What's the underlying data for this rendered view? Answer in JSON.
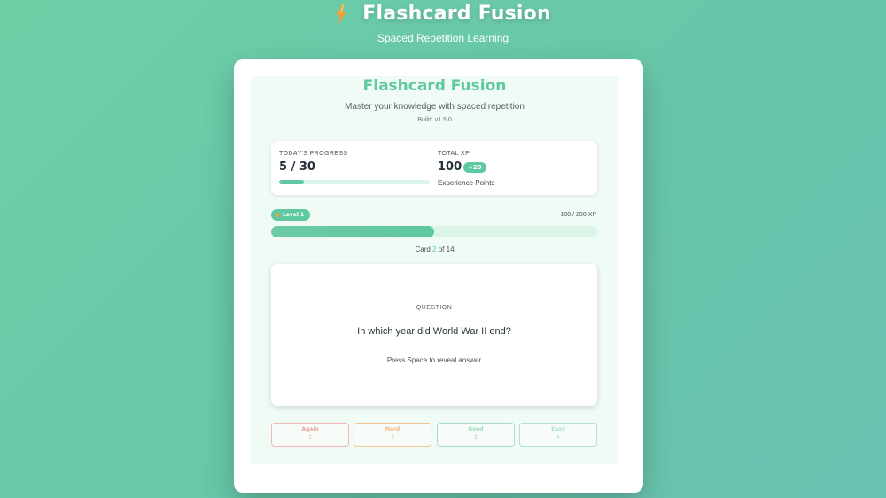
{
  "app": {
    "title": "Flashcard Fusion",
    "subtitle": "Spaced Repetition Learning",
    "icon": "lightning-bolt-icon"
  },
  "panel": {
    "title": "Flashcard Fusion",
    "tagline": "Master your knowledge with spaced repetition",
    "build": "Build: v1.5.0"
  },
  "stats": {
    "progress_label": "TODAY'S PROGRESS",
    "progress_value": "5 / 30",
    "progress_fraction": 0.1667,
    "xp_label": "TOTAL XP",
    "xp_value": "100",
    "xp_bonus": "+20",
    "xp_caption": "Experience Points"
  },
  "level": {
    "badge": "Level 1",
    "xp_text": "100 / 200 XP",
    "fraction": 0.5
  },
  "counter": {
    "prefix": "Card ",
    "current": "2",
    "suffix": " of 14"
  },
  "question": {
    "label": "QUESTION",
    "text": "In which year did World War II end?",
    "hint": "Press Space to reveal answer"
  },
  "ratings": [
    {
      "label": "Again",
      "key": "1",
      "color": "#e8a5a5",
      "border": "#f0b8b8"
    },
    {
      "label": "Hard",
      "key": "2",
      "color": "#f0b77d",
      "border": "#f3c48e"
    },
    {
      "label": "Good",
      "key": "3",
      "color": "#9fd8c1",
      "border": "#a9dcc8"
    },
    {
      "label": "Easy",
      "key": "4",
      "color": "#a6e0c9",
      "border": "#b2e3cf"
    }
  ],
  "colors": {
    "accent": "#5ec8a0",
    "bolt": "#f4a03a"
  }
}
